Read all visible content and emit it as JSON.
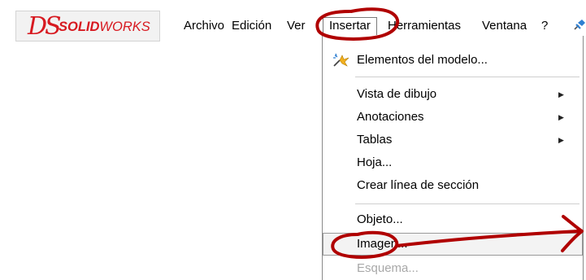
{
  "logo": {
    "ds": "DS",
    "brand_bold": "SOLID",
    "brand_thin": "WORKS"
  },
  "menubar": {
    "items": [
      {
        "label": "Archivo"
      },
      {
        "label": "Edición"
      },
      {
        "label": "Ver"
      },
      {
        "label": "Insertar"
      },
      {
        "label": "Herramientas"
      },
      {
        "label": "Ventana"
      },
      {
        "label": "?"
      }
    ]
  },
  "dropdown": {
    "items": [
      {
        "label": "Elementos del modelo...",
        "icon": "model-features-icon"
      },
      {
        "label": "Vista de dibujo",
        "submenu": true
      },
      {
        "label": "Anotaciones",
        "submenu": true
      },
      {
        "label": "Tablas",
        "submenu": true
      },
      {
        "label": "Hoja..."
      },
      {
        "label": "Crear línea de sección"
      },
      {
        "label": "Objeto..."
      },
      {
        "label": "Imagen...",
        "highlighted": true
      },
      {
        "label": "Esquema...",
        "disabled": true
      }
    ]
  },
  "colors": {
    "brand": "#d71920",
    "annotation": "#b00000"
  },
  "icons": {
    "pin": "pin-icon",
    "submenu": "chevron-right-icon"
  }
}
